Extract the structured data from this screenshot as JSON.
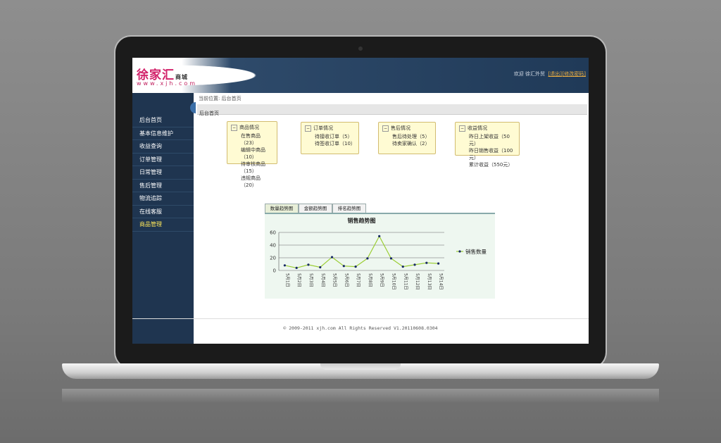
{
  "header": {
    "logo_text": "徐家汇",
    "logo_tag": "商城",
    "logo_sub": "www.xjh.com",
    "welcome": "欢迎   徐汇外贸",
    "link_logout": "[退出]",
    "link_password": "[修改密码]"
  },
  "sidebar": {
    "items": [
      {
        "label": "后台首页"
      },
      {
        "label": "基本信息维护"
      },
      {
        "label": "收益查询"
      },
      {
        "label": "订单管理"
      },
      {
        "label": "日常管理"
      },
      {
        "label": "售后管理"
      },
      {
        "label": "物流追踪"
      },
      {
        "label": "在线客服"
      },
      {
        "label": "商品管理"
      }
    ]
  },
  "breadcrumb": "当前位置: 后台首页",
  "page_title": "后台首页",
  "cards": [
    {
      "title": "商品情况",
      "rows": [
        "在售商品（23）",
        "编辑中商品（10）",
        "待审核商品（15）",
        "违规商品（20）"
      ]
    },
    {
      "title": "订单情况",
      "rows": [
        "待接收订单（5）",
        "待签收订单（10）"
      ]
    },
    {
      "title": "售后情况",
      "rows": [
        "售后待处理（5）",
        "待卖家确认（2）"
      ]
    },
    {
      "title": "收益情况",
      "rows": [
        "昨日上架收益（50元）",
        "昨日销售收益（100元）",
        "累计收益（550元）"
      ]
    }
  ],
  "tabs": [
    "数量趋势图",
    "金额趋势图",
    "排名趋势图"
  ],
  "footer": "© 2009-2011 xjh.com All Rights Reserved V1.20110608.0304",
  "chart_data": {
    "type": "line",
    "title": "销售趋势图",
    "categories": [
      "5月1日",
      "5月2日",
      "5月3日",
      "5月4日",
      "5月5日",
      "5月6日",
      "5月7日",
      "5月8日",
      "5月9日",
      "5月10日",
      "5月11日",
      "5月12日",
      "5月13日",
      "5月14日"
    ],
    "series": [
      {
        "name": "销售数量",
        "values": [
          8,
          4,
          9,
          5,
          21,
          7,
          6,
          19,
          54,
          19,
          6,
          9,
          12,
          11
        ],
        "color": "#9acd32"
      }
    ],
    "yticks": [
      0,
      20,
      40,
      60
    ],
    "ylim": [
      0,
      60
    ],
    "grid": true,
    "legend": "right"
  }
}
